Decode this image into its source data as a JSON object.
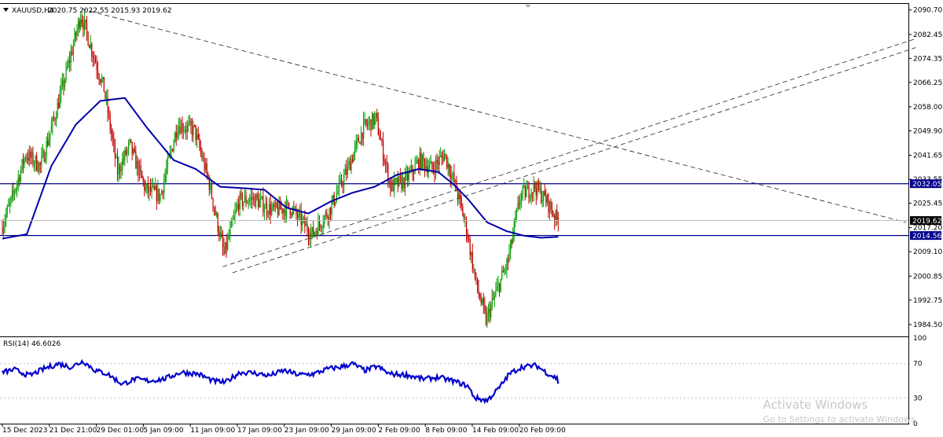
{
  "header": {
    "symbol": "XAUUSD,H4",
    "ohlc": "2020.75 2022.55 2015.93 2019.62",
    "rsi_label": "RSI(14) 46.6026"
  },
  "price_axis": {
    "ticks": [
      "2090.70",
      "2082.45",
      "2074.35",
      "2066.25",
      "2058.00",
      "2049.90",
      "2041.65",
      "2033.55",
      "2025.45",
      "2017.20",
      "2009.10",
      "2000.85",
      "1992.75",
      "1984.50"
    ],
    "tick_values": [
      2090.7,
      2082.45,
      2074.35,
      2066.25,
      2058.0,
      2049.9,
      2041.65,
      2033.55,
      2025.45,
      2017.2,
      2009.1,
      2000.85,
      1992.75,
      1984.5
    ]
  },
  "levels": [
    {
      "label": "2032.05",
      "value": 2032.05,
      "color": "#00008b"
    },
    {
      "label": "2014.56",
      "value": 2014.56,
      "color": "#00008b"
    }
  ],
  "current_price": {
    "label": "2019.62",
    "value": 2019.62
  },
  "rsi_axis": {
    "ticks": [
      "100",
      "70",
      "30",
      "0"
    ],
    "tick_values": [
      100,
      70,
      30,
      0
    ]
  },
  "time_axis": {
    "labels": [
      "15 Dec 2023",
      "21 Dec 21:00",
      "29 Dec 01:00",
      "5 Jan 09:00",
      "11 Jan 09:00",
      "17 Jan 09:00",
      "23 Jan 09:00",
      "29 Jan 09:00",
      "2 Feb 09:00",
      "8 Feb 09:00",
      "14 Feb 09:00",
      "20 Feb 09:00"
    ]
  },
  "watermark": {
    "title": "Activate Windows",
    "subtitle": "Go to Settings to activate Windows."
  },
  "colors": {
    "bull": "#00a000",
    "bear": "#c00000",
    "ma": "#0000aa",
    "rsi": "#0000cc",
    "level": "#00008b",
    "trend": "#222222"
  },
  "chart_data": {
    "type": "candlestick",
    "symbol": "XAUUSD",
    "timeframe": "H4",
    "last_bar": {
      "open": 2020.75,
      "high": 2022.55,
      "low": 2015.93,
      "close": 2019.62
    },
    "key_path": [
      [
        0,
        2017
      ],
      [
        8,
        2026
      ],
      [
        20,
        2042
      ],
      [
        32,
        2038
      ],
      [
        44,
        2055
      ],
      [
        56,
        2074
      ],
      [
        65,
        2089
      ],
      [
        72,
        2080
      ],
      [
        84,
        2064
      ],
      [
        95,
        2036
      ],
      [
        105,
        2045
      ],
      [
        118,
        2030
      ],
      [
        130,
        2028
      ],
      [
        144,
        2052
      ],
      [
        158,
        2050
      ],
      [
        170,
        2032
      ],
      [
        182,
        2008
      ],
      [
        194,
        2026
      ],
      [
        206,
        2027
      ],
      [
        222,
        2023
      ],
      [
        236,
        2024
      ],
      [
        254,
        2015
      ],
      [
        268,
        2023
      ],
      [
        282,
        2036
      ],
      [
        296,
        2051
      ],
      [
        306,
        2054
      ],
      [
        318,
        2031
      ],
      [
        330,
        2033
      ],
      [
        342,
        2040
      ],
      [
        352,
        2037
      ],
      [
        362,
        2042
      ],
      [
        372,
        2030
      ],
      [
        380,
        2017
      ],
      [
        388,
        1998
      ],
      [
        396,
        1986
      ],
      [
        404,
        1995
      ],
      [
        414,
        2006
      ],
      [
        424,
        2028
      ],
      [
        436,
        2031
      ],
      [
        446,
        2026
      ],
      [
        454,
        2019.62
      ]
    ],
    "moving_average": [
      [
        0,
        2013.5
      ],
      [
        20,
        2015
      ],
      [
        40,
        2038
      ],
      [
        60,
        2052
      ],
      [
        80,
        2060
      ],
      [
        100,
        2061
      ],
      [
        118,
        2051
      ],
      [
        140,
        2040
      ],
      [
        158,
        2037
      ],
      [
        178,
        2031
      ],
      [
        198,
        2030.5
      ],
      [
        214,
        2030
      ],
      [
        232,
        2024
      ],
      [
        250,
        2022
      ],
      [
        268,
        2026
      ],
      [
        286,
        2029
      ],
      [
        304,
        2031
      ],
      [
        322,
        2035
      ],
      [
        340,
        2037
      ],
      [
        356,
        2036
      ],
      [
        368,
        2032
      ],
      [
        380,
        2027
      ],
      [
        396,
        2019
      ],
      [
        412,
        2016
      ],
      [
        426,
        2014.5
      ],
      [
        440,
        2013.8
      ],
      [
        454,
        2014.1
      ]
    ],
    "rsi_key_path": [
      [
        0,
        60
      ],
      [
        10,
        63
      ],
      [
        22,
        56
      ],
      [
        34,
        64
      ],
      [
        46,
        70
      ],
      [
        56,
        66
      ],
      [
        66,
        73
      ],
      [
        76,
        62
      ],
      [
        86,
        58
      ],
      [
        98,
        46
      ],
      [
        108,
        52
      ],
      [
        120,
        50
      ],
      [
        132,
        52
      ],
      [
        146,
        60
      ],
      [
        160,
        58
      ],
      [
        172,
        50
      ],
      [
        182,
        48
      ],
      [
        194,
        60
      ],
      [
        206,
        59
      ],
      [
        218,
        56
      ],
      [
        230,
        62
      ],
      [
        242,
        57
      ],
      [
        254,
        58
      ],
      [
        266,
        64
      ],
      [
        276,
        66
      ],
      [
        286,
        70
      ],
      [
        296,
        62
      ],
      [
        306,
        67
      ],
      [
        316,
        58
      ],
      [
        330,
        57
      ],
      [
        344,
        52
      ],
      [
        356,
        54
      ],
      [
        368,
        50
      ],
      [
        380,
        44
      ],
      [
        386,
        30
      ],
      [
        396,
        27
      ],
      [
        406,
        42
      ],
      [
        414,
        58
      ],
      [
        424,
        66
      ],
      [
        436,
        68
      ],
      [
        446,
        58
      ],
      [
        454,
        52
      ]
    ],
    "trendlines": [
      {
        "style": "dashed",
        "from": [
          65,
          2091
        ],
        "to": [
          738,
          2019
        ]
      },
      {
        "style": "dashed",
        "from": [
          180,
          2004
        ],
        "to": [
          746,
          2081
        ]
      },
      {
        "style": "dashed",
        "from": [
          188,
          2002
        ],
        "to": [
          746,
          2078
        ]
      }
    ],
    "horizontal_levels": [
      2032.05,
      2014.56
    ],
    "ylim": [
      1980.5,
      2093.0
    ],
    "rsi_levels": [
      70,
      30
    ],
    "rsi_ylim": [
      0,
      100
    ],
    "current_rsi": 46.6026
  }
}
